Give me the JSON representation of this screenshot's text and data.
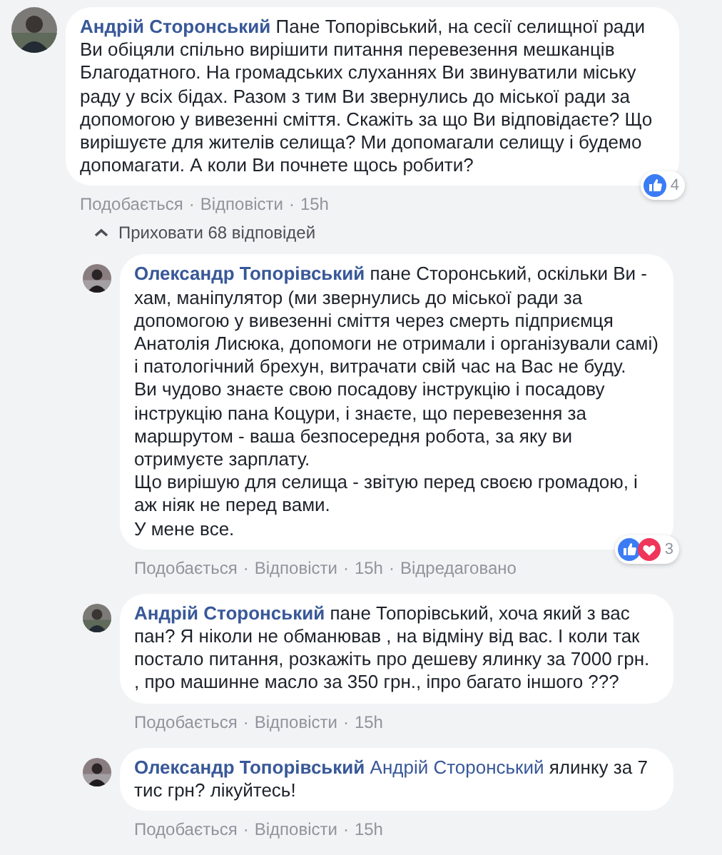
{
  "separator": "·",
  "comment": {
    "author": "Андрій Сторонський",
    "text": "Пане Топорівський, на сесії селищної ради Ви обіцяли спільно вирішити питання перевезення мешканців Благодатного. На громадських слуханнях Ви звинуватили міську раду у всіх бідах. Разом з тим Ви звернулись до міської ради за допомогою у вивезенні сміття. Скажіть за що Ви відповідаєте? Що вирішуєте для жителів селища? Ми допомагали селищу і будемо допомагати. А коли Ви почнете щось робити?",
    "reactions": [
      {
        "kind": "like"
      }
    ],
    "reaction_count": "4",
    "actions": [
      "Подобається",
      "Відповісти",
      "15h"
    ]
  },
  "hide_replies": "Приховати 68 відповідей",
  "replies": [
    {
      "author": "Олександр Топорівський",
      "text": "пане Сторонський, оскільки Ви - хам, маніпулятор (ми звернулись до міської ради за допомогою у вивезенні сміття через смерть підприємця Анатолія Лисюка, допомоги не отримали і організували самі) і патологічний брехун, витрачати свій час на Вас не буду.\nВи чудово знаєте свою посадову інструкцію і посадову інструкцію пана Коцури, і знаєте, що перевезення за маршрутом - ваша безпосередня робота, за яку ви отримуєте зарплату.\nЩо вирішую для селища - звітую перед своєю громадою, і аж ніяк не перед вами.\nУ мене все.",
      "reactions": [
        {
          "kind": "like"
        },
        {
          "kind": "love"
        }
      ],
      "reaction_count": "3",
      "actions": [
        "Подобається",
        "Відповісти",
        "15h",
        "Відредаговано"
      ]
    },
    {
      "author": "Андрій Сторонський",
      "text": "пане Топорівський, хоча який з вас пан? Я ніколи не обманював , на відміну від вас. І коли так постало питання, розкажіть про дешеву ялинку за 7000 грн. , про машинне масло за 350 грн., іпро багато іншого ???",
      "actions": [
        "Подобається",
        "Відповісти",
        "15h"
      ]
    },
    {
      "author": "Олександр Топорівський",
      "mention": "Андрій Сторонський",
      "text": "ялинку за 7 тис грн? лікуйтесь!",
      "actions": [
        "Подобається",
        "Відповісти",
        "15h"
      ]
    }
  ]
}
